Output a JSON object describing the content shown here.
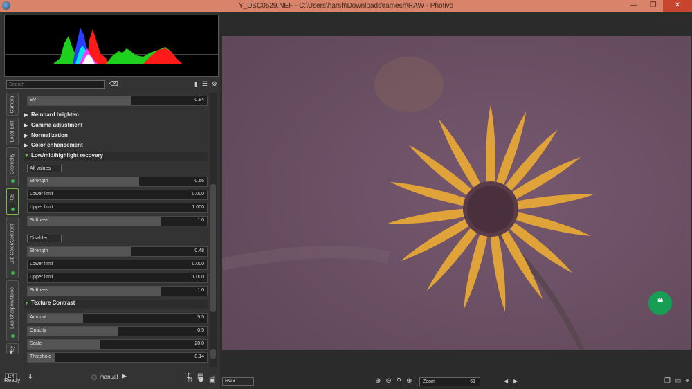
{
  "window": {
    "title": "Y_DSC0529.NEF - C:\\Users\\harsh\\Downloads\\ramesh\\RAW - Photivo"
  },
  "colors": {
    "accent_green": "#5cc24a",
    "title_bg": "#d9836a",
    "image_tint": "#6b4f66",
    "flower_yellow": "#e0a33a"
  },
  "search": {
    "placeholder": "Search"
  },
  "tabs": [
    {
      "label": "Camera",
      "active": false
    },
    {
      "label": "Local Edit",
      "active": false
    },
    {
      "label": "Geometry",
      "active": false
    },
    {
      "label": "RGB",
      "active": true
    },
    {
      "label": "Lab Color/Contrast",
      "active": false
    },
    {
      "label": "Lab Sharpen/Noise",
      "active": false
    },
    {
      "label": "Ey",
      "active": false
    }
  ],
  "panel": {
    "ev": {
      "label": "EV",
      "value": "0.84",
      "fill": 0.58
    },
    "sections": [
      {
        "label": "Reinhard brighten"
      },
      {
        "label": "Gamma adjustment"
      },
      {
        "label": "Normalization"
      },
      {
        "label": "Color enhancement"
      }
    ],
    "recovery": {
      "title": "Low/mid/highlight recovery",
      "mode1": "All values",
      "group1": [
        {
          "label": "Strength",
          "value": "0.66",
          "fill": 0.62
        },
        {
          "label": "Lower limit",
          "value": "0.000",
          "fill": 0.0
        },
        {
          "label": "Upper limit",
          "value": "1.000",
          "fill": 0.0
        },
        {
          "label": "Softness",
          "value": "1.0",
          "fill": 0.74
        }
      ],
      "mode2": "Disabled",
      "group2": [
        {
          "label": "Strength",
          "value": "0.48",
          "fill": 0.58
        },
        {
          "label": "Lower limit",
          "value": "0.000",
          "fill": 0.0
        },
        {
          "label": "Upper limit",
          "value": "1.000",
          "fill": 0.0
        },
        {
          "label": "Softness",
          "value": "1.0",
          "fill": 0.74
        }
      ]
    },
    "texture": {
      "title": "Texture Contrast",
      "sliders": [
        {
          "label": "Amount",
          "value": "5.5",
          "fill": 0.31
        },
        {
          "label": "Opacity",
          "value": "0.5",
          "fill": 0.5
        },
        {
          "label": "Scale",
          "value": "20.0",
          "fill": 0.4
        },
        {
          "label": "Threshold",
          "value": "0.14",
          "fill": 0.15
        }
      ]
    }
  },
  "bottom_left": {
    "zoom_ratio": "1:4",
    "mode": "manual"
  },
  "status": {
    "text": "Ready"
  },
  "viewer": {
    "channel": "RGB",
    "zoom_label": "Zoom",
    "zoom_value": "61"
  }
}
